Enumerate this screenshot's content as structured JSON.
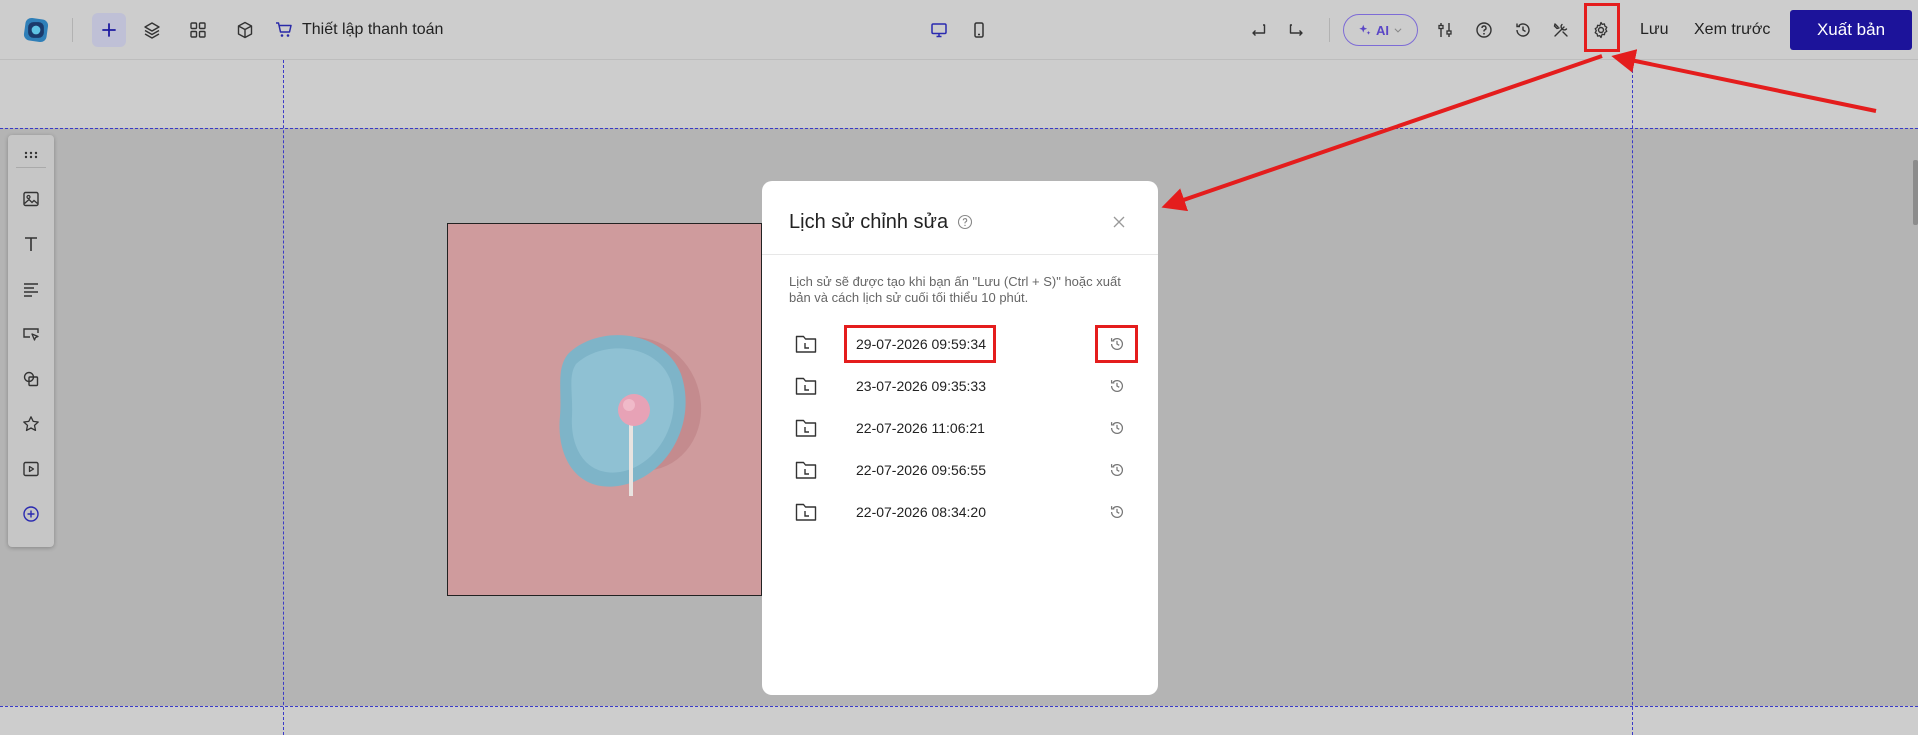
{
  "header": {
    "checkout_label": "Thiết lập thanh toán",
    "ai_label": "AI",
    "save_label": "Lưu",
    "preview_label": "Xem trước",
    "publish_label": "Xuất bản"
  },
  "modal": {
    "title": "Lịch sử chỉnh sửa",
    "description": "Lịch sử sẽ được tạo khi bạn ấn \"Lưu (Ctrl + S)\" hoặc xuất bản và cách lịch sử cuối tối thiểu 10 phút.",
    "history": [
      {
        "date": "29-07-2026 09:59:34"
      },
      {
        "date": "23-07-2026 09:35:33"
      },
      {
        "date": "22-07-2026 11:06:21"
      },
      {
        "date": "22-07-2026 09:56:55"
      },
      {
        "date": "22-07-2026 08:34:20"
      }
    ]
  },
  "left_toolbar": {
    "items": [
      "drag-handle-icon",
      "image-icon",
      "text-icon",
      "paragraph-icon",
      "button-icon",
      "shape-icon",
      "star-icon",
      "video-icon",
      "add-circle-icon"
    ]
  },
  "colors": {
    "accent": "#1c139a",
    "highlight": "#e41d1d",
    "ai_accent": "#5a46c6",
    "guide": "#3a3ac8"
  }
}
